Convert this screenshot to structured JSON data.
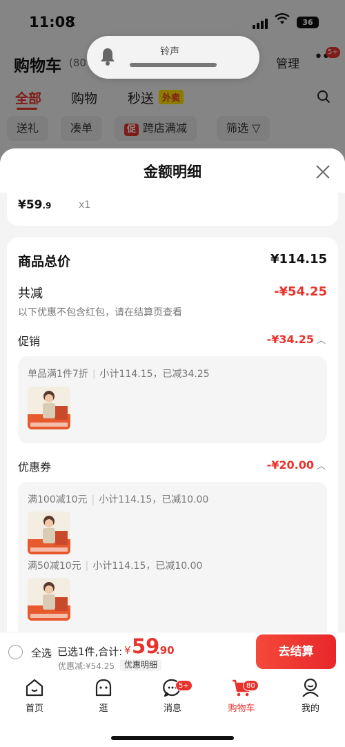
{
  "status_bar": {
    "time": "11:08",
    "battery": "36"
  },
  "notification": {
    "label": "铃声"
  },
  "cart_header": {
    "title": "购物车",
    "count": "(80",
    "manage": "管理",
    "more_badge": "5+"
  },
  "tabs": [
    {
      "label": "全部",
      "active": true
    },
    {
      "label": "购物",
      "active": false
    },
    {
      "label": "秒送",
      "active": false
    }
  ],
  "tab_badge": "外卖",
  "chips": [
    "送礼",
    "凑单",
    "跨店满减",
    "筛选 ▽"
  ],
  "chip_badge": "促",
  "sheet": {
    "title": "金额明细",
    "top_item": {
      "price_main": "¥59",
      "price_dec": ".9",
      "qty": "x1"
    },
    "goods_total_label": "商品总价",
    "goods_total_value": "¥114.15",
    "total_reduce_label": "共减",
    "total_reduce_value": "-¥54.25",
    "note": "以下优惠不包含红包，请在结算页查看",
    "promotion": {
      "label": "促销",
      "value": "-¥34.25",
      "rule": "单品满1件7折",
      "detail": "小计114.15，已减34.25"
    },
    "coupon": {
      "label": "优惠券",
      "value": "-¥20.00",
      "items": [
        {
          "rule": "满100减10元",
          "detail": "小计114.15，已减10.00"
        },
        {
          "rule": "满50减10元",
          "detail": "小计114.15，已减10.00"
        }
      ]
    }
  },
  "bottom_bar": {
    "select_all": "全选",
    "selected_text": "已选1件,合计:",
    "currency": "¥",
    "total_main": "59",
    "total_dec": ".90",
    "discount": "优惠减:¥54.25",
    "detail_button": "优惠明细",
    "checkout": "去结算"
  },
  "tabbar": [
    {
      "label": "首页",
      "icon": "home-icon"
    },
    {
      "label": "逛",
      "icon": "explore-icon"
    },
    {
      "label": "消息",
      "icon": "message-icon",
      "badge": "5+"
    },
    {
      "label": "购物车",
      "icon": "cart-icon",
      "badge": "80",
      "active": true
    },
    {
      "label": "我的",
      "icon": "profile-icon"
    }
  ],
  "colors": {
    "accent": "#e8332c",
    "waimai_bg": "#ffe000"
  }
}
